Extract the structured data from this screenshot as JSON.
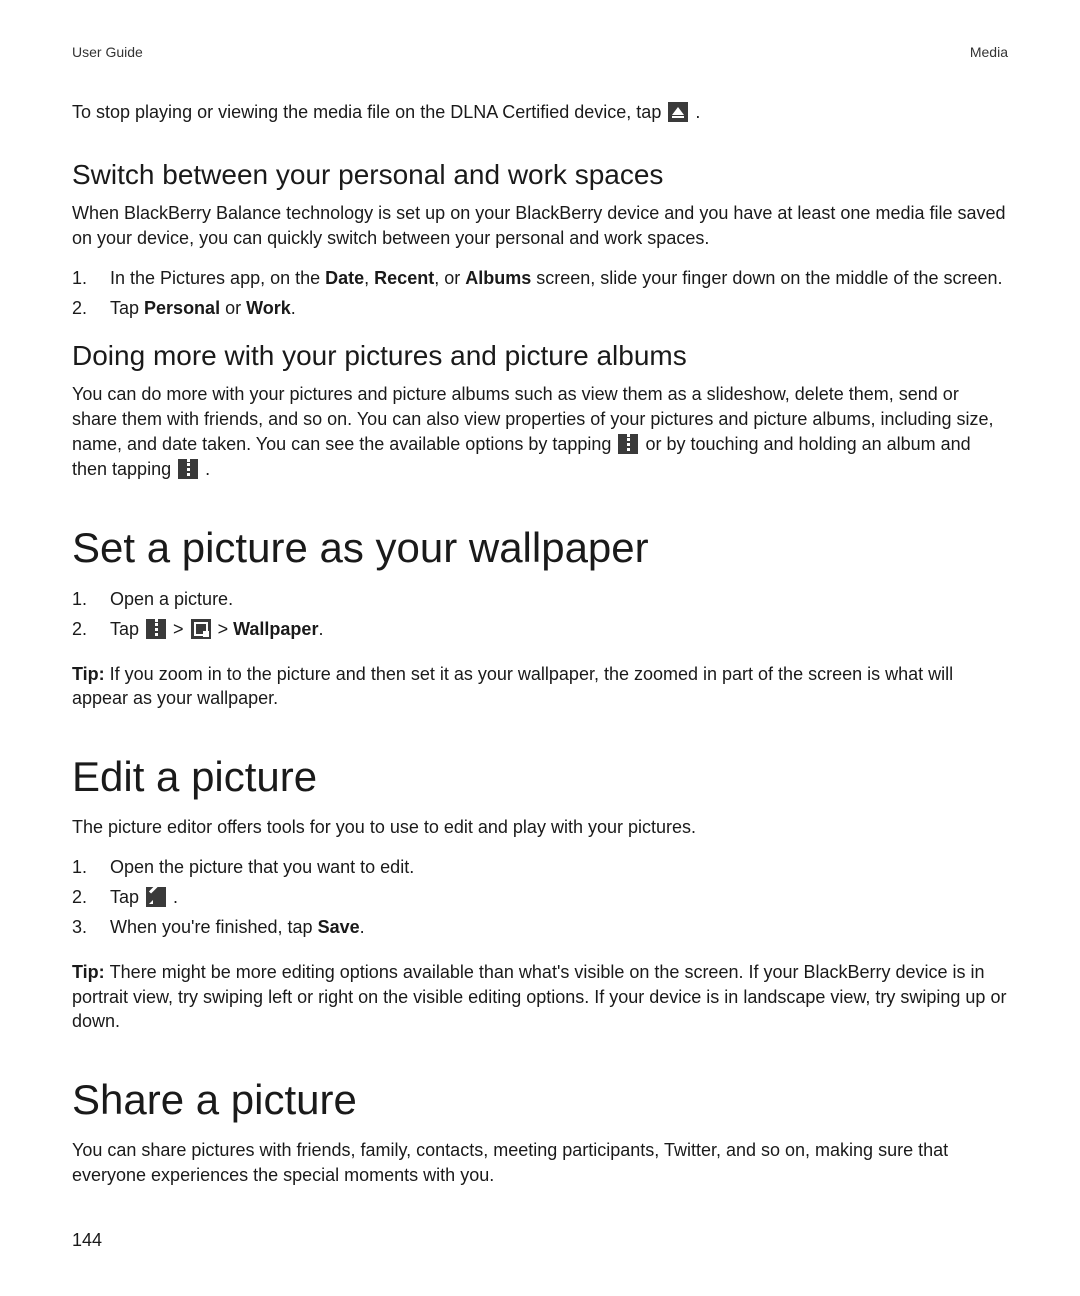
{
  "header": {
    "left": "User Guide",
    "right": "Media"
  },
  "intro": {
    "pre": "To stop playing or viewing the media file on the DLNA Certified device, tap ",
    "post": " ."
  },
  "switch": {
    "heading": "Switch between your personal and work spaces",
    "para": "When BlackBerry Balance technology is set up on your BlackBerry device and you have at least one media file saved on your device, you can quickly switch between your personal and work spaces.",
    "step1": {
      "pre": "In the Pictures app, on the ",
      "b1": "Date",
      "mid1": ", ",
      "b2": "Recent",
      "mid2": ", or ",
      "b3": "Albums",
      "post": " screen, slide your finger down on the middle of the screen."
    },
    "step2": {
      "pre": "Tap ",
      "b1": "Personal",
      "mid": " or ",
      "b2": "Work",
      "post": "."
    }
  },
  "doing": {
    "heading": "Doing more with your pictures and picture albums",
    "para_pre": "You can do more with your pictures and picture albums such as view them as a slideshow, delete them, send or share them with friends, and so on. You can also view properties of your pictures and picture albums, including size, name, and date taken. You can see the available options by tapping ",
    "para_mid": " or by touching and holding an album and then tapping ",
    "para_post": " ."
  },
  "wallpaper": {
    "heading": "Set a picture as your wallpaper",
    "step1": "Open a picture.",
    "step2": {
      "pre": "Tap ",
      "gt1": " > ",
      "gt2": " > ",
      "b": "Wallpaper",
      "post": "."
    },
    "tip": {
      "label": "Tip: ",
      "text": "If you zoom in to the picture and then set it as your wallpaper, the zoomed in part of the screen is what will appear as your wallpaper."
    }
  },
  "edit": {
    "heading": "Edit a picture",
    "para": "The picture editor offers tools for you to use to edit and play with your pictures.",
    "step1": "Open the picture that you want to edit.",
    "step2": {
      "pre": "Tap ",
      "post": " ."
    },
    "step3": {
      "pre": "When you're finished, tap ",
      "b": "Save",
      "post": "."
    },
    "tip": {
      "label": "Tip: ",
      "text": "There might be more editing options available than what's visible on the screen. If your BlackBerry device is in portrait view, try swiping left or right on the visible editing options. If your device is in landscape view, try swiping up or down."
    }
  },
  "share": {
    "heading": "Share a picture",
    "para": "You can share pictures with friends, family, contacts, meeting participants, Twitter, and so on, making sure that everyone experiences the special moments with you."
  },
  "page_number": "144",
  "nums": {
    "n1": "1.",
    "n2": "2.",
    "n3": "3."
  }
}
